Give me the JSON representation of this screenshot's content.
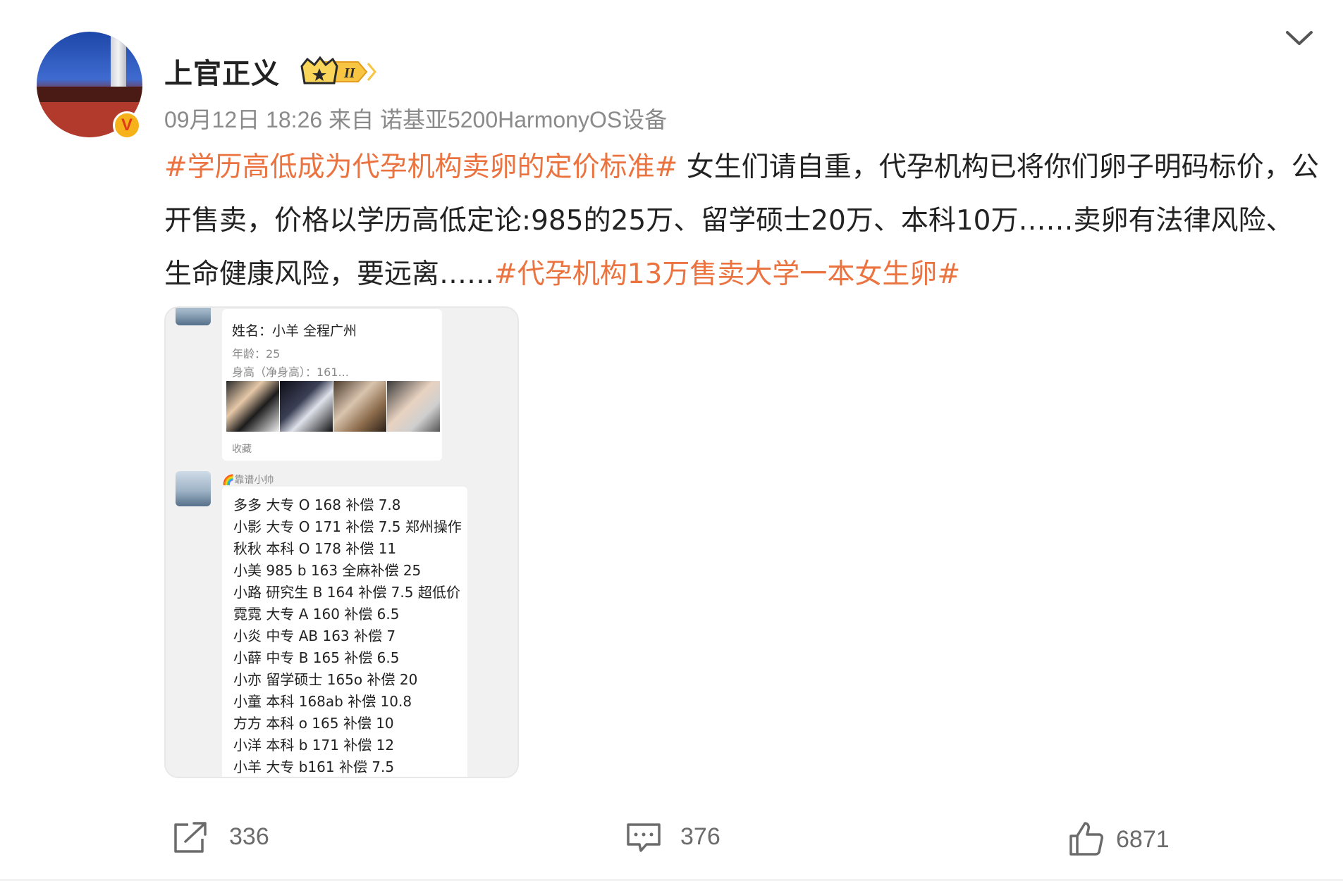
{
  "post": {
    "username": "上官正义",
    "meta": "09月12日 18:26  来自 诺基亚5200HarmonyOS设备",
    "badge_letter": "V",
    "crown_level": "II",
    "content": {
      "tag1": "#学历高低成为代孕机构卖卵的定价标准#",
      "body": " 女生们请自重，代孕机构已将你们卵子明码标价，公开售卖，价格以学历高低定论:985的25万、留学硕士20万、本科10万……卖卵有法律风险、生命健康风险，要远离……",
      "tag2": "#代孕机构13万售卖大学一本女生卵#"
    }
  },
  "image": {
    "card1": {
      "name_line": "姓名：小羊   全程广州",
      "age_line": "年龄：25",
      "height_line": "身高（净身高）：161...",
      "fav_label": "收藏"
    },
    "sender": "🌈靠谱小帅",
    "lines": [
      "多多 大专 O 168 补偿 7.8",
      "小影 大专 O 171 补偿 7.5 郑州操作",
      "秋秋 本科 O 178 补偿 11",
      "小美 985 b 163 全麻补偿 25",
      "小路 研究生 B 164 补偿 7.5 超低价",
      "霓霓 大专 A 160 补偿 6.5",
      "小炎 中专 AB 163 补偿 7",
      "小薛 中专 B 165 补偿 6.5",
      "小亦 留学硕士 165o 补偿 20",
      "小童 本科 168ab 补偿 10.8",
      "方方 本科 o 165 补偿 10",
      "小洋 本科 b 171 补偿 12",
      "小羊 大专 b161 补偿 7.5"
    ]
  },
  "actions": {
    "share_count": "336",
    "comment_count": "376",
    "like_count": "6871"
  },
  "colors": {
    "topic": "#eb7340",
    "meta": "#8a8a8a",
    "text": "#222222"
  }
}
